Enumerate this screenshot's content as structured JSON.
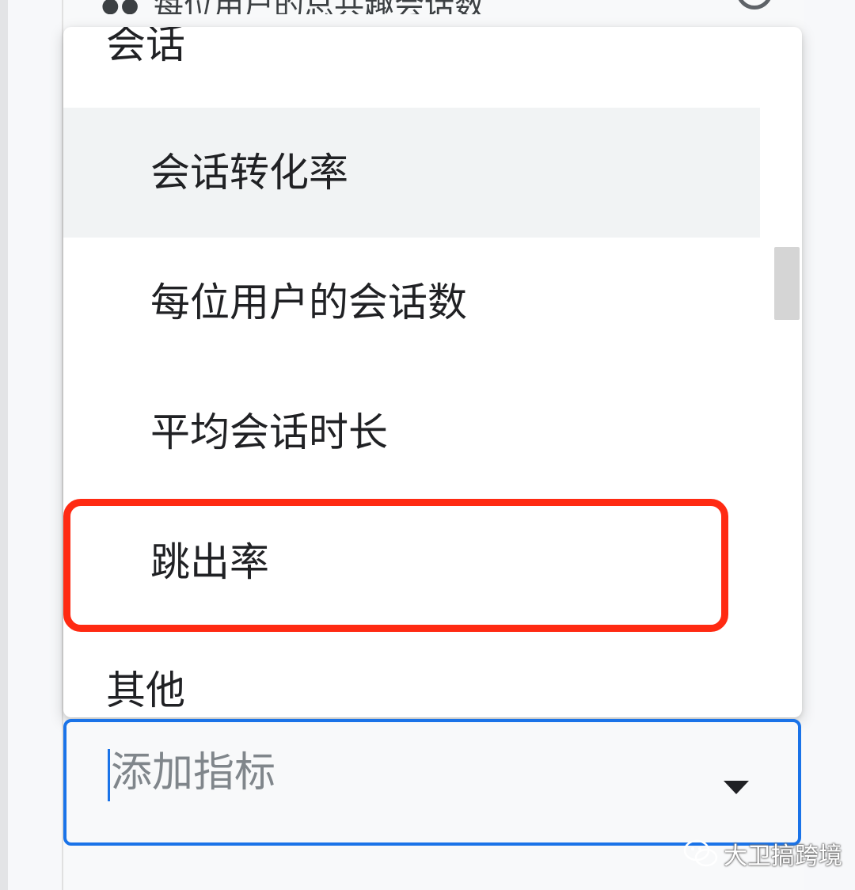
{
  "behind_row": {
    "label": "每位用户的总共趣会话数"
  },
  "dropdown": {
    "groups": [
      {
        "header": "会话",
        "options": [
          "会话转化率",
          "每位用户的会话数",
          "平均会话时长",
          "跳出率"
        ]
      },
      {
        "header": "其他",
        "options": []
      }
    ],
    "hovered_option": "会话转化率",
    "highlighted_option": "跳出率"
  },
  "add_metric": {
    "placeholder": "添加指标",
    "icon": "dropdown-arrow-icon"
  },
  "watermark": {
    "text": "大卫搞跨境",
    "icon": "wechat-icon"
  },
  "colors": {
    "highlight": "#ff2a12",
    "focus": "#1a73e8",
    "hover_bg": "#f1f3f4"
  }
}
